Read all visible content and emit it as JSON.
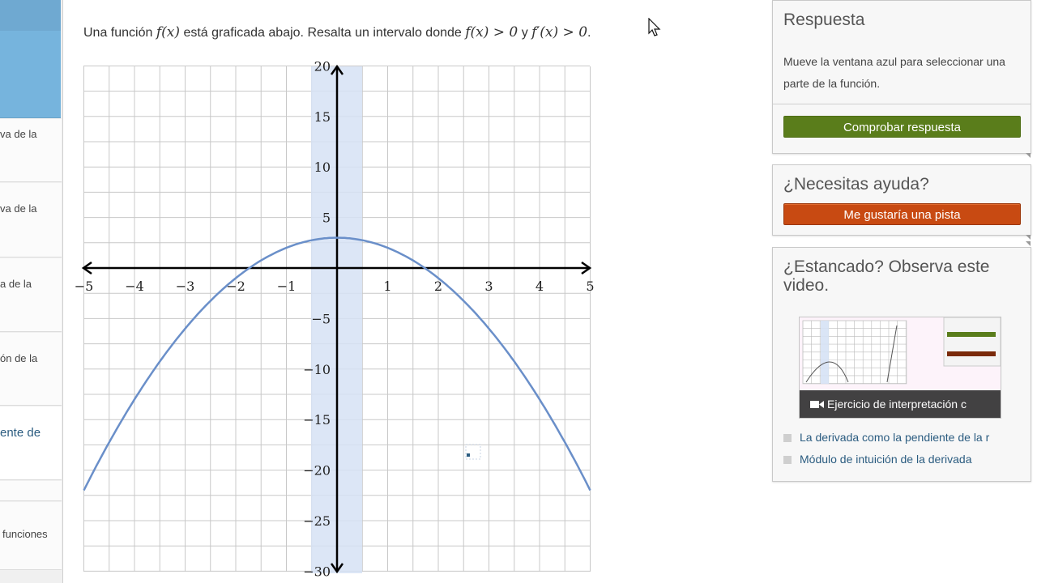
{
  "sidebar": {
    "items": [
      {
        "label": "va de la"
      },
      {
        "label": "va de la"
      },
      {
        "label": "a de la"
      },
      {
        "label": "ón de la"
      },
      {
        "label": "ente de"
      },
      {
        "label": ""
      },
      {
        "label": "funciones"
      }
    ]
  },
  "question": {
    "prefix": "Una función ",
    "fx": "f(x)",
    "middle": " está graficada abajo. Resalta un intervalo donde ",
    "cond1": "f(x) > 0",
    "and": " y ",
    "cond2": "f′(x) > 0",
    "end": "."
  },
  "graph": {
    "x_ticks": [
      "−5",
      "−4",
      "−3",
      "−2",
      "−1",
      "1",
      "2",
      "3",
      "4",
      "5"
    ],
    "y_ticks": [
      "20",
      "15",
      "10",
      "5",
      "−5",
      "−10",
      "−15",
      "−20",
      "−25",
      "−30"
    ],
    "function_color": "#6a8fc9",
    "highlight_color": "#d6e2f5"
  },
  "answer_panel": {
    "title": "Respuesta",
    "instructions": "Mueve la ventana azul para seleccionar una parte de la función.",
    "check_button": "Comprobar respuesta",
    "check_color": "#5a7d1b"
  },
  "help_panel": {
    "title": "¿Necesitas ayuda?",
    "hint_button": "Me gustaría una pista",
    "hint_color": "#c84a12"
  },
  "stuck_panel": {
    "title": "¿Estancado? Observa este video.",
    "video_caption": "Ejercicio de interpretación c",
    "links": [
      "La derivada como la pendiente de la r",
      "Módulo de intuición de la derivada"
    ]
  }
}
